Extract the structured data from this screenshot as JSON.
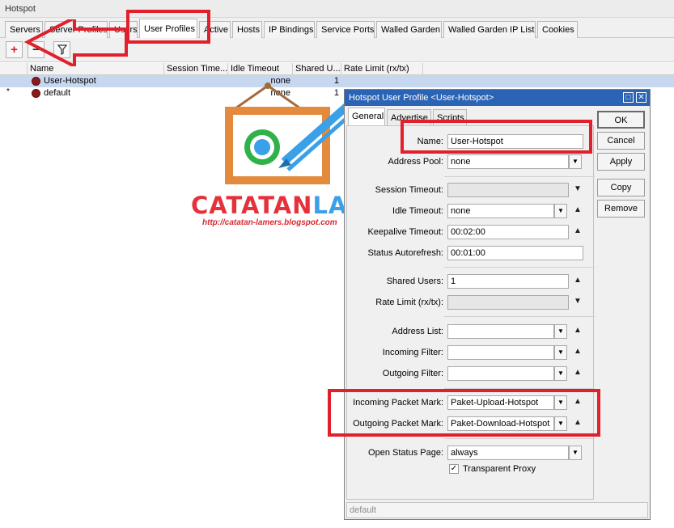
{
  "window_title": "Hotspot",
  "tabs": [
    "Servers",
    "Server Profiles",
    "Users",
    "User Profiles",
    "Active",
    "Hosts",
    "IP Bindings",
    "Service Ports",
    "Walled Garden",
    "Walled Garden IP List",
    "Cookies"
  ],
  "active_tab": "User Profiles",
  "toolbar": {
    "add": "+",
    "remove": "−",
    "filter": "filter"
  },
  "table": {
    "columns": [
      "Name",
      "Session Time...",
      "Idle Timeout",
      "Shared U...",
      "Rate Limit (rx/tx)"
    ],
    "rows": [
      {
        "marker": "",
        "name": "User-Hotspot",
        "session": "",
        "idle": "none",
        "shared": "1",
        "rate": ""
      },
      {
        "marker": "*",
        "name": "default",
        "session": "",
        "idle": "none",
        "shared": "1",
        "rate": ""
      }
    ]
  },
  "watermark": {
    "text_red": "CATATAN",
    "text_blue": "LAMERS",
    "url": "http://catatan-lamers.blogspot.com"
  },
  "dialog": {
    "title": "Hotspot User Profile <User-Hotspot>",
    "tabs": [
      "General",
      "Advertise",
      "Scripts"
    ],
    "active_tab": "General",
    "fields": {
      "name": {
        "label": "Name:",
        "value": "User-Hotspot"
      },
      "address_pool": {
        "label": "Address Pool:",
        "value": "none"
      },
      "session_timeout": {
        "label": "Session Timeout:",
        "value": ""
      },
      "idle_timeout": {
        "label": "Idle Timeout:",
        "value": "none"
      },
      "keepalive_timeout": {
        "label": "Keepalive Timeout:",
        "value": "00:02:00"
      },
      "status_autorefresh": {
        "label": "Status Autorefresh:",
        "value": "00:01:00"
      },
      "shared_users": {
        "label": "Shared Users:",
        "value": "1"
      },
      "rate_limit": {
        "label": "Rate Limit (rx/tx):",
        "value": ""
      },
      "address_list": {
        "label": "Address List:",
        "value": ""
      },
      "incoming_filter": {
        "label": "Incoming Filter:",
        "value": ""
      },
      "outgoing_filter": {
        "label": "Outgoing Filter:",
        "value": ""
      },
      "incoming_packet_mark": {
        "label": "Incoming Packet Mark:",
        "value": "Paket-Upload-Hotspot"
      },
      "outgoing_packet_mark": {
        "label": "Outgoing Packet Mark:",
        "value": "Paket-Download-Hotspot"
      },
      "open_status_page": {
        "label": "Open Status Page:",
        "value": "always"
      }
    },
    "transparent_proxy": {
      "label": "Transparent Proxy",
      "checked": true
    },
    "buttons": {
      "ok": "OK",
      "cancel": "Cancel",
      "apply": "Apply",
      "copy": "Copy",
      "remove": "Remove"
    },
    "status_text": "default"
  },
  "colors": {
    "highlight_red": "#e0202a",
    "title_blue": "#2b63b5",
    "selected_row": "#c7d7f0"
  }
}
